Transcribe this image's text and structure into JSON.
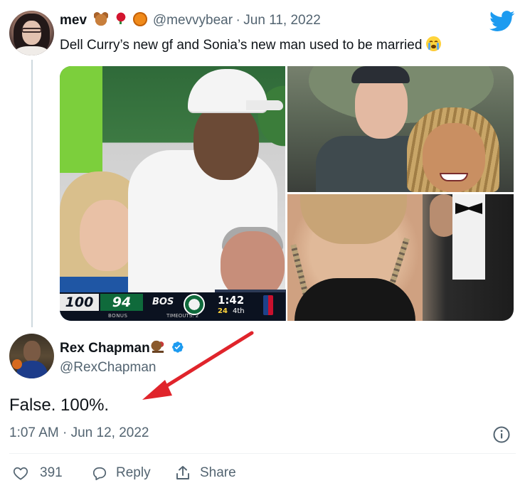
{
  "quoted_tweet": {
    "name": "mev",
    "name_emojis": [
      "teddy-bear",
      "rose",
      "basketball"
    ],
    "handle": "@mevvybear",
    "separator": "·",
    "date": "Jun 11, 2022",
    "text": "Dell Curry’s new gf and Sonia’s new man used to be married",
    "text_emoji": "loudly-crying-face",
    "scoreboard": {
      "away_score": "100",
      "home_score": "94",
      "bonus": "BONUS",
      "team": "BOS",
      "timeouts": "TIMEOUTS: 2",
      "clock": "1:42",
      "shot_clock": "24",
      "period": "4th"
    }
  },
  "reply_tweet": {
    "name": "Rex Chapman",
    "name_emoji": "horse-racing",
    "verified": true,
    "handle": "@RexChapman",
    "text": "False. 100%.",
    "timestamp": "1:07 AM · Jun 12, 2022"
  },
  "actions": {
    "like_count": "391",
    "reply_label": "Reply",
    "share_label": "Share"
  },
  "colors": {
    "twitter_blue": "#1d9bf0",
    "text_primary": "#0f1419",
    "text_secondary": "#536471",
    "annotation_arrow": "#e0242b"
  },
  "icons": [
    "twitter-bird-icon",
    "verified-badge-icon",
    "info-icon",
    "heart-icon",
    "reply-bubble-icon",
    "share-icon"
  ]
}
